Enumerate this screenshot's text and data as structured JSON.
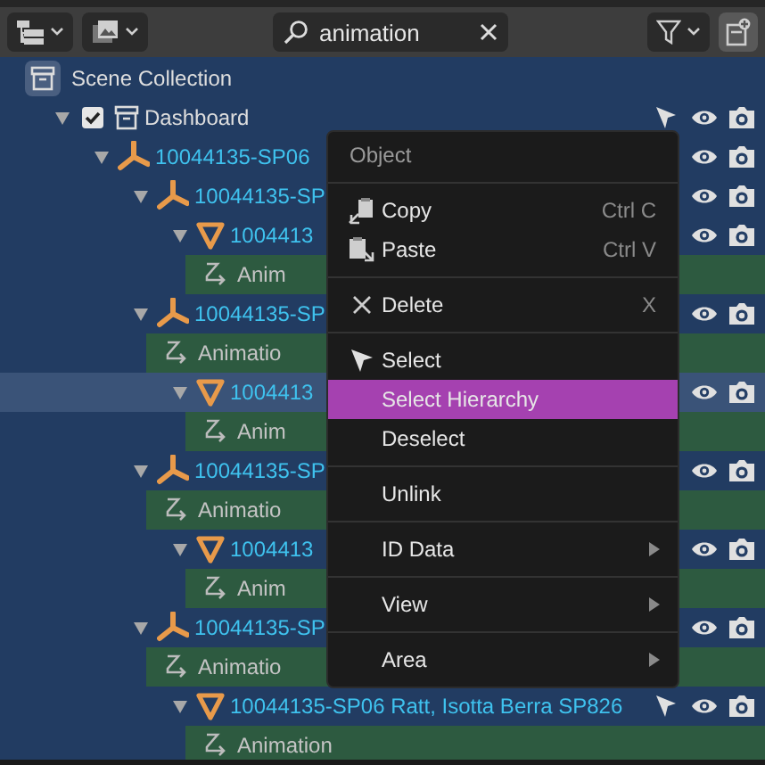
{
  "toolbar": {
    "search": {
      "value": "animation"
    }
  },
  "tree": [
    {
      "kind": "scene_collection",
      "label": "Scene Collection",
      "highlighted": false,
      "children": [
        {
          "kind": "collection",
          "label": "Dashboard",
          "checked": true,
          "expanded": true,
          "restrict_select": true,
          "highlighted": false,
          "children": [
            {
              "kind": "armature",
              "label": "10044135-SP06",
              "expanded": true,
              "highlighted": false,
              "children": [
                {
                  "kind": "armature",
                  "label": "10044135-SP",
                  "expanded": true,
                  "highlighted": false,
                  "children": [
                    {
                      "kind": "mesh",
                      "label": "1004413",
                      "expanded": true,
                      "highlighted": false,
                      "children": [
                        {
                          "kind": "animation",
                          "label": "Anim",
                          "highlighted": false
                        }
                      ]
                    }
                  ]
                },
                {
                  "kind": "armature",
                  "label": "10044135-SP",
                  "expanded": true,
                  "highlighted": false,
                  "children": [
                    {
                      "kind": "animation",
                      "label": "Animatio",
                      "highlighted": false
                    },
                    {
                      "kind": "mesh",
                      "label": "1004413",
                      "expanded": true,
                      "highlighted": true,
                      "children": [
                        {
                          "kind": "animation",
                          "label": "Anim",
                          "highlighted": false
                        }
                      ]
                    }
                  ]
                },
                {
                  "kind": "armature",
                  "label": "10044135-SP",
                  "expanded": true,
                  "highlighted": false,
                  "children": [
                    {
                      "kind": "animation",
                      "label": "Animatio",
                      "highlighted": false
                    },
                    {
                      "kind": "mesh",
                      "label": "1004413",
                      "expanded": true,
                      "highlighted": false,
                      "children": [
                        {
                          "kind": "animation",
                          "label": "Anim",
                          "highlighted": false
                        }
                      ]
                    }
                  ]
                },
                {
                  "kind": "armature",
                  "label": "10044135-SP",
                  "expanded": true,
                  "highlighted": false,
                  "children": [
                    {
                      "kind": "animation",
                      "label": "Animatio",
                      "highlighted": false
                    },
                    {
                      "kind": "mesh",
                      "label": "10044135-SP06 Ratt, Isotta Berra SP826",
                      "expanded": true,
                      "restrict_select": true,
                      "highlighted": false,
                      "children": [
                        {
                          "kind": "animation",
                          "label": "Animation",
                          "highlighted": false
                        }
                      ]
                    }
                  ]
                }
              ]
            }
          ]
        }
      ]
    }
  ],
  "context_menu": {
    "items": [
      {
        "kind": "title",
        "label": "Object"
      },
      {
        "kind": "separator"
      },
      {
        "kind": "copy",
        "label": "Copy",
        "shortcut": "Ctrl C",
        "selected": false
      },
      {
        "kind": "paste",
        "label": "Paste",
        "shortcut": "Ctrl V",
        "selected": false
      },
      {
        "kind": "separator"
      },
      {
        "kind": "delete",
        "label": "Delete",
        "shortcut": "X",
        "selected": false
      },
      {
        "kind": "separator"
      },
      {
        "kind": "select",
        "label": "Select",
        "selected": false
      },
      {
        "kind": "item",
        "label": "Select Hierarchy",
        "selected": true
      },
      {
        "kind": "item",
        "label": "Deselect",
        "selected": false
      },
      {
        "kind": "separator"
      },
      {
        "kind": "item",
        "label": "Unlink",
        "selected": false
      },
      {
        "kind": "separator"
      },
      {
        "kind": "submenu",
        "label": "ID Data",
        "selected": false
      },
      {
        "kind": "separator"
      },
      {
        "kind": "submenu",
        "label": "View",
        "selected": false
      },
      {
        "kind": "separator"
      },
      {
        "kind": "submenu",
        "label": "Area",
        "selected": false
      }
    ]
  }
}
